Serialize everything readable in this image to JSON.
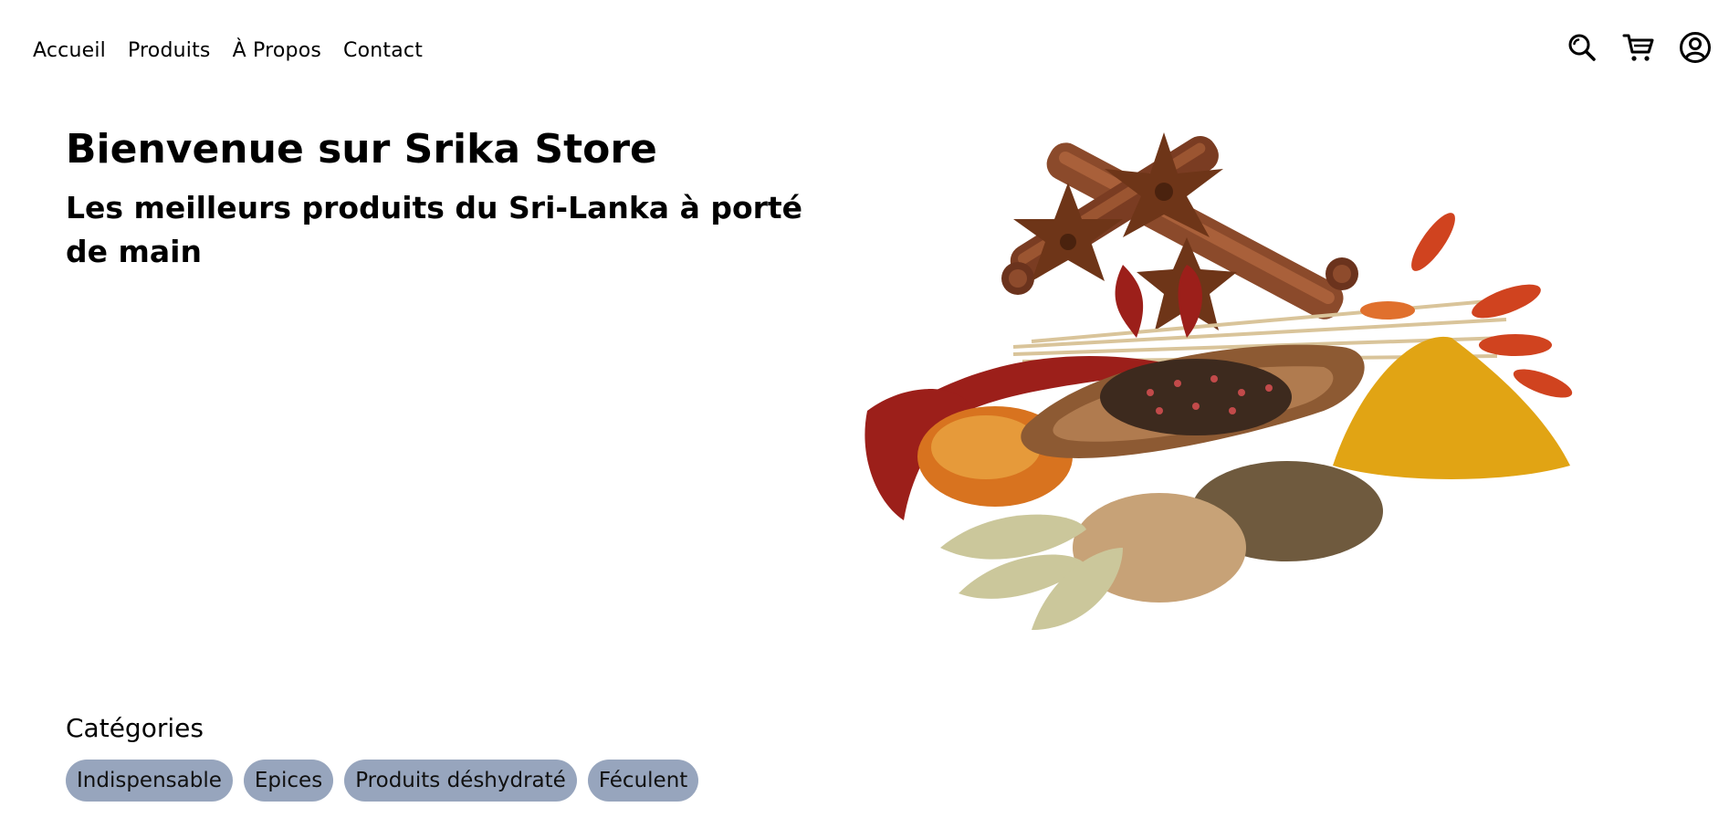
{
  "nav": {
    "items": [
      "Accueil",
      "Produits",
      "À Propos",
      "Contact"
    ]
  },
  "header_icons": {
    "search": "search-icon",
    "cart": "cart-icon",
    "account": "user-circle-icon"
  },
  "hero": {
    "title": "Bienvenue sur Srika Store",
    "subtitle": "Les meilleurs produits du Sri-Lanka à porté de main",
    "image": "spices-illustration"
  },
  "categories": {
    "title": "Catégories",
    "items": [
      "Indispensable",
      "Epices",
      "Produits déshydraté",
      "Féculent"
    ]
  },
  "colors": {
    "chip_bg": "#97a5bd",
    "text": "#000000"
  }
}
